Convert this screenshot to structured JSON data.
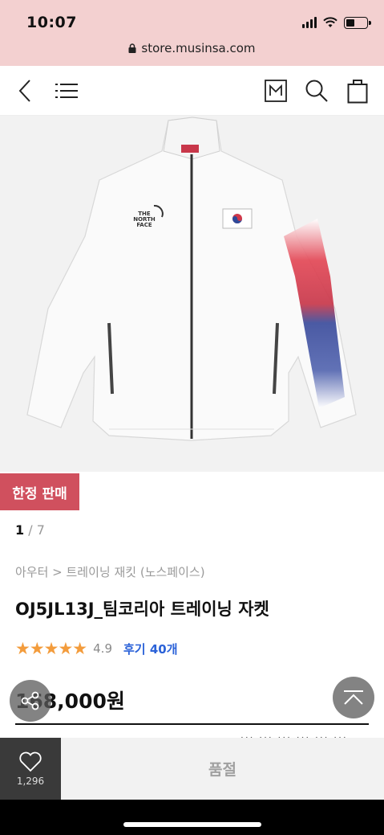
{
  "status": {
    "time": "10:07"
  },
  "browser": {
    "url": "store.musinsa.com"
  },
  "product": {
    "badge": "한정 판매",
    "pager_current": "1",
    "pager_total": " / 7",
    "breadcrumb": "아우터 > 트레이닝 재킷 (노스페이스)",
    "title": "OJ5JL13J_팀코리아 트레이닝 자켓",
    "stars": "★★★★★",
    "rating": "4.9",
    "reviews": "후기 40개",
    "price": "168,000원",
    "partial_text": "··· ··· ··· ··· ··· ···"
  },
  "bottom": {
    "like_count": "1,296",
    "soldout_label": "품절"
  },
  "colors": {
    "status_bg": "#f3d0d0",
    "badge": "#d0505e",
    "review_link": "#2b62d8",
    "star": "#f39c3c"
  },
  "icons": [
    "back-icon",
    "menu-icon",
    "musinsa-m-icon",
    "search-icon",
    "bag-icon",
    "share-icon",
    "scroll-top-icon",
    "heart-icon",
    "lock-icon"
  ]
}
